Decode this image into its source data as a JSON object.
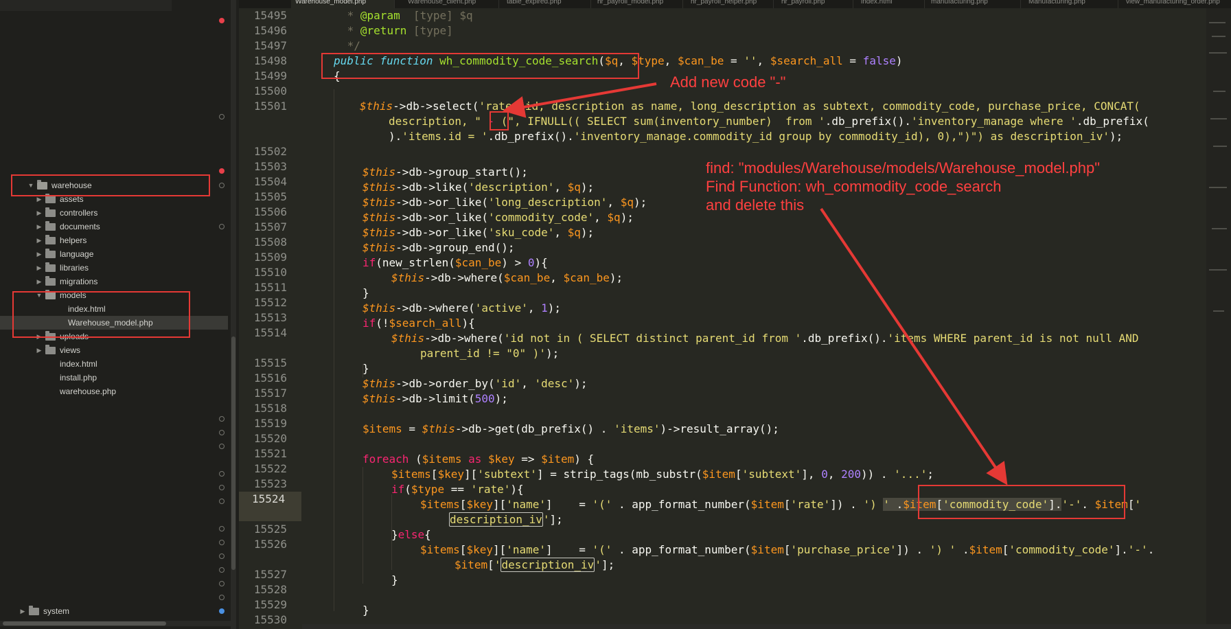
{
  "tabs": [
    "Warehouse_model.php",
    "Warehouse_client.php",
    "table_expired.php",
    "hr_payroll_model.php",
    "hr_payroll_helper.php",
    "hr_payroll.php",
    "index.html",
    "manufacturing.php",
    "Manufacturing.php",
    "view_manufacturing_order.php"
  ],
  "sidebar": {
    "items": [
      {
        "label": "warehouse",
        "depth": 0,
        "type": "folder",
        "open": true
      },
      {
        "label": "assets",
        "depth": 1,
        "type": "folder",
        "open": false
      },
      {
        "label": "controllers",
        "depth": 1,
        "type": "folder",
        "open": false
      },
      {
        "label": "documents",
        "depth": 1,
        "type": "folder",
        "open": false
      },
      {
        "label": "helpers",
        "depth": 1,
        "type": "folder",
        "open": false
      },
      {
        "label": "language",
        "depth": 1,
        "type": "folder",
        "open": false
      },
      {
        "label": "libraries",
        "depth": 1,
        "type": "folder",
        "open": false
      },
      {
        "label": "migrations",
        "depth": 1,
        "type": "folder",
        "open": false
      },
      {
        "label": "models",
        "depth": 1,
        "type": "folder",
        "open": true
      },
      {
        "label": "index.html",
        "depth": 2,
        "type": "file"
      },
      {
        "label": "Warehouse_model.php",
        "depth": 2,
        "type": "file",
        "selected": true
      },
      {
        "label": "uploads",
        "depth": 1,
        "type": "folder",
        "open": false
      },
      {
        "label": "views",
        "depth": 1,
        "type": "folder",
        "open": false
      },
      {
        "label": "index.html",
        "depth": 1,
        "type": "file"
      },
      {
        "label": "install.php",
        "depth": 1,
        "type": "file"
      },
      {
        "label": "warehouse.php",
        "depth": 1,
        "type": "file"
      }
    ],
    "bottom_item": {
      "label": "system",
      "type": "folder",
      "open": false
    }
  },
  "editor": {
    "current_line": "15524",
    "lines": [
      {
        "n": "15495"
      },
      {
        "n": "15496"
      },
      {
        "n": "15497"
      },
      {
        "n": "15498"
      },
      {
        "n": "15499"
      },
      {
        "n": "15500"
      },
      {
        "n": "15501"
      },
      {
        "n": "15502"
      },
      {
        "n": "15503"
      },
      {
        "n": "15504"
      },
      {
        "n": "15505"
      },
      {
        "n": "15506"
      },
      {
        "n": "15507"
      },
      {
        "n": "15508"
      },
      {
        "n": "15509"
      },
      {
        "n": "15510"
      },
      {
        "n": "15511"
      },
      {
        "n": "15512"
      },
      {
        "n": "15513"
      },
      {
        "n": "15514"
      },
      {
        "n": "15515"
      },
      {
        "n": "15516"
      },
      {
        "n": "15517"
      },
      {
        "n": "15518"
      },
      {
        "n": "15519"
      },
      {
        "n": "15520"
      },
      {
        "n": "15521"
      },
      {
        "n": "15522"
      },
      {
        "n": "15523"
      },
      {
        "n": "15524"
      },
      {
        "n": "15525"
      },
      {
        "n": "15526"
      },
      {
        "n": "15527"
      },
      {
        "n": "15528"
      },
      {
        "n": "15529"
      },
      {
        "n": "15530"
      }
    ]
  },
  "annotations": {
    "add_code": "Add new code \"-\"",
    "find_file": "find: \"modules/Warehouse/models/Warehouse_model.php\"",
    "find_function": "Find Function: wh_commodity_code_search",
    "delete_this": "and delete this"
  },
  "colors": {
    "editor_bg": "#272822",
    "sidebar_bg": "#1f1f1c",
    "annotation_red": "#e53935"
  }
}
